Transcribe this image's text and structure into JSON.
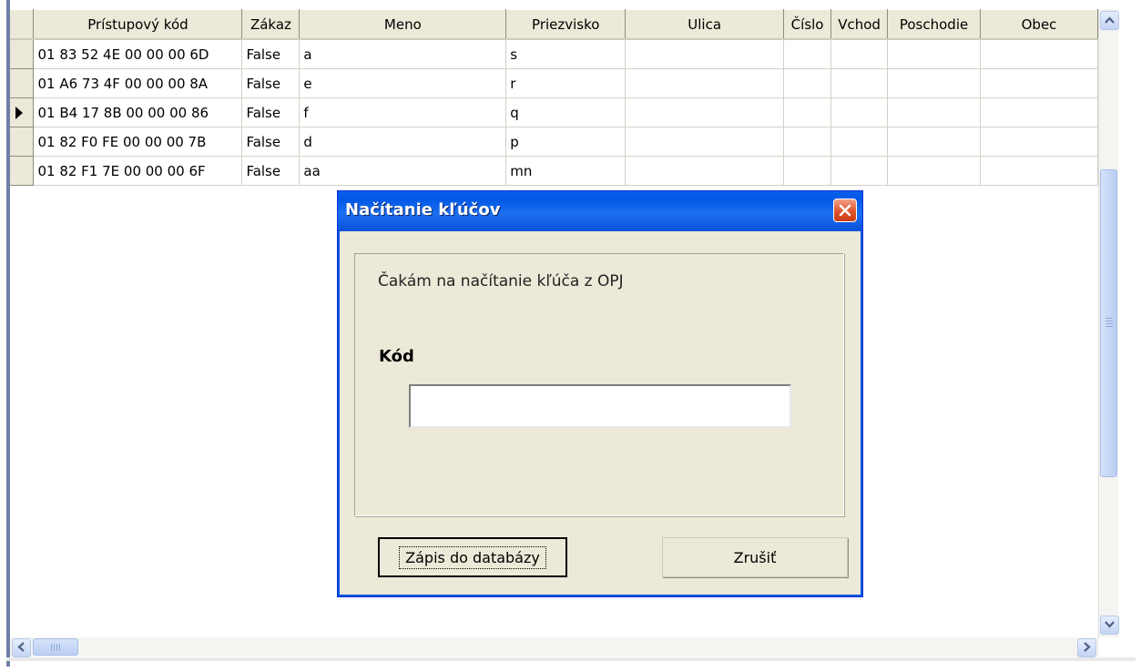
{
  "grid": {
    "columns": [
      "",
      "Prístupový kód",
      "Zákaz",
      "Meno",
      "Priezvisko",
      "Ulica",
      "Číslo",
      "Vchod",
      "Poschodie",
      "Obec"
    ],
    "rows": [
      {
        "current": false,
        "cells": [
          "01 83 52 4E 00 00 00 6D",
          "False",
          "a",
          "s",
          "",
          "",
          "",
          "",
          ""
        ]
      },
      {
        "current": false,
        "cells": [
          "01 A6 73 4F 00 00 00 8A",
          "False",
          "e",
          "r",
          "",
          "",
          "",
          "",
          ""
        ]
      },
      {
        "current": true,
        "cells": [
          "01 B4 17 8B 00 00 00 86",
          "False",
          "f",
          "q",
          "",
          "",
          "",
          "",
          ""
        ]
      },
      {
        "current": false,
        "cells": [
          "01 82 F0 FE 00 00 00 7B",
          "False",
          "d",
          "p",
          "",
          "",
          "",
          "",
          ""
        ]
      },
      {
        "current": false,
        "cells": [
          "01 82 F1 7E 00 00 00 6F",
          "False",
          "aa",
          "mn",
          "",
          "",
          "",
          "",
          ""
        ]
      }
    ]
  },
  "dialog": {
    "title": "Načítanie kľúčov",
    "message": "Čakám na načítanie kľúča z OPJ",
    "code_label": "Kód",
    "code_value": "",
    "save_label": "Zápis do databázy",
    "cancel_label": "Zrušiť"
  },
  "colors": {
    "titlebar": "#0058e6",
    "dialog_bg": "#ece9d8",
    "close_button": "#e0542c"
  }
}
